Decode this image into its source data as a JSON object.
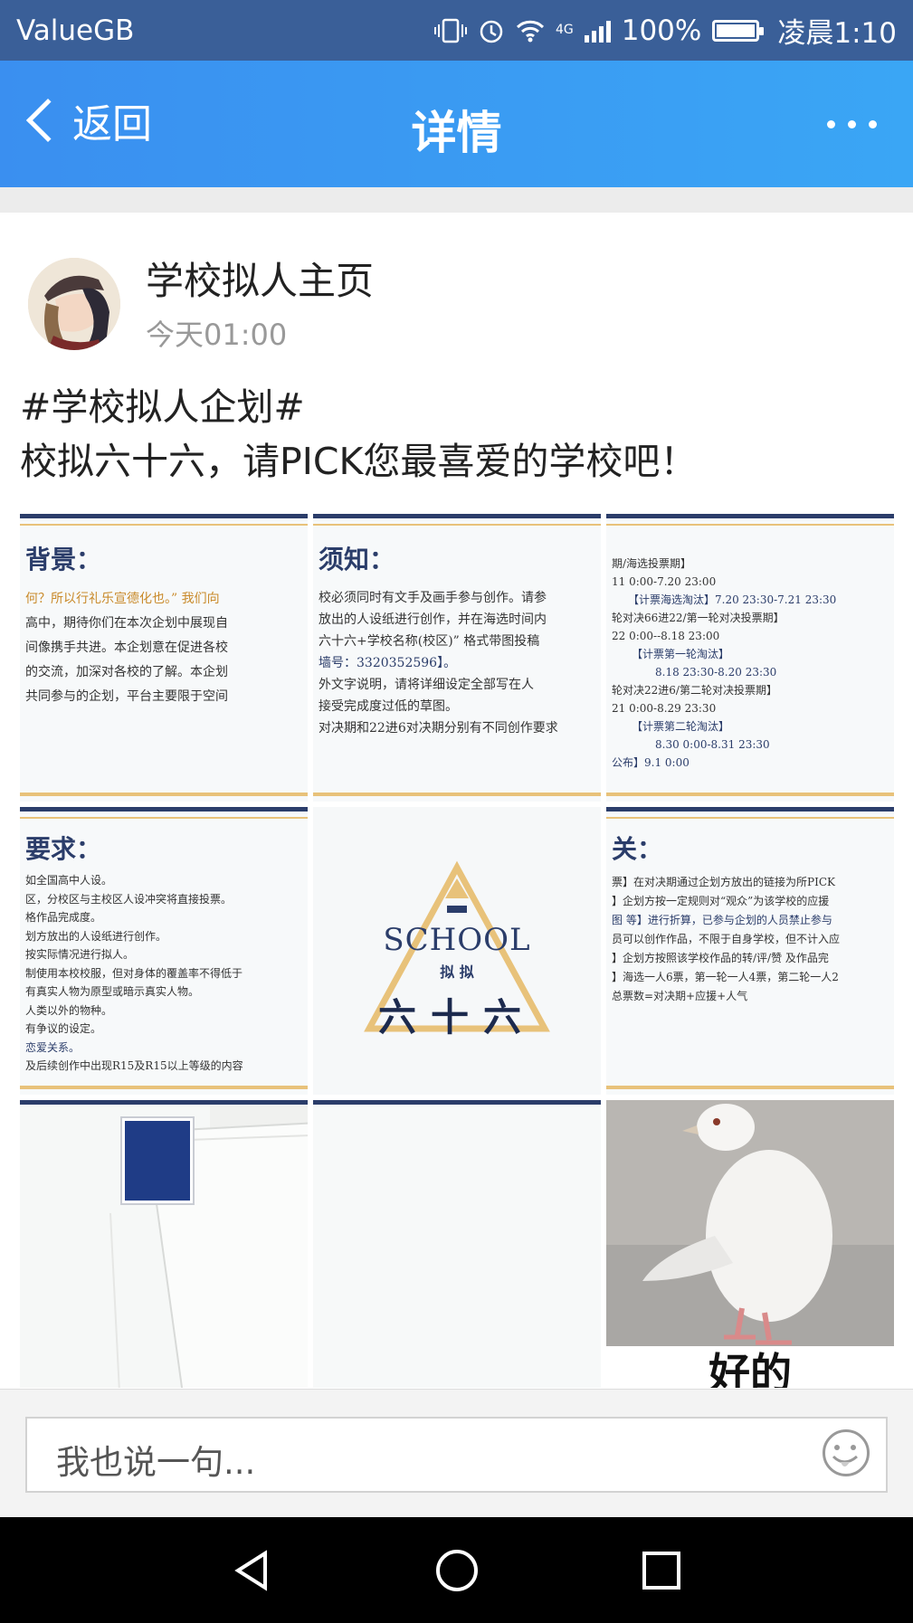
{
  "status_bar": {
    "carrier": "ValueGB",
    "network": "4G",
    "battery": "100%",
    "battery_level": 1.0,
    "time": "凌晨1:10"
  },
  "navbar": {
    "back_label": "返回",
    "title": "详情",
    "more_icon": "more-dots-icon"
  },
  "post": {
    "author": "学校拟人主页",
    "time": "今天01:00",
    "hashtag": "#学校拟人企划#",
    "text": "校拟六十六，请PICK您最喜爱的学校吧！"
  },
  "images": {
    "img1": {
      "title": "背景：",
      "lines": [
        "何？所以行礼乐宣德化也。” 我们向",
        "高中，期待你们在本次企划中展现自",
        "间像携手共进。本企划意在促进各校",
        "的交流，加深对各校的了解。本企划",
        "共同参与的企划，平台主要限于空间"
      ]
    },
    "img2": {
      "title": "须知：",
      "lines": [
        "校必须同时有文手及画手参与创作。请参",
        "放出的人设纸进行创作，并在海选时间内",
        "六十六+学校名称(校区)” 格式带图投稿",
        "墙号：3320352596】。",
        "",
        "外文字说明，请将详细设定全部写在人",
        "",
        "接受完成度过低的草图。",
        "",
        "对决期和22进6对决期分别有不同创作要求"
      ]
    },
    "img3": {
      "lines": [
        "期/海选投票期】",
        "11 0:00-7.20 23:00",
        "【计票海选淘汰】7.20 23:30-7.21 23:30",
        "轮对决66进22/第一轮对决投票期】",
        "22 0:00--8.18 23:00",
        "【计票第一轮淘汰】",
        "8.18 23:30-8.20 23:30",
        "轮对决22进6/第二轮对决投票期】",
        "21 0:00-8.29 23:30",
        "【计票第二轮淘汰】",
        "8.30 0:00-8.31 23:30",
        "",
        "公布】9.1 0:00"
      ]
    },
    "img4": {
      "title": "要求：",
      "lines": [
        "如全国高中人设。",
        "区，分校区与主校区人设冲突将直接投票。",
        "格作品完成度。",
        "划方放出的人设纸进行创作。",
        "按实际情况进行拟人。",
        "制使用本校校服，但对身体的覆盖率不得低于",
        "有真实人物为原型或暗示真实人物。",
        "人类以外的物种。",
        "有争议的设定。",
        "恋爱关系。",
        "及后续创作中出现R15及R15以上等级的内容"
      ]
    },
    "img5": {
      "school": "SCHOOL",
      "small": "拟 拟",
      "big": "六十六"
    },
    "img6": {
      "title": "关：",
      "lines": [
        "票】在对决期通过企划方放出的链接为所PICK",
        "】企划方按一定规则对“观众”为该学校的应援",
        "图 等】进行折算，已参与企划的人员禁止参与",
        "员可以创作作品，不限于自身学校，但不计入应",
        "",
        "】企划方按照该学校作品的转/评/赞 及作品完",
        "",
        "】海选一人6票，第一轮一人4票，第二轮一人2",
        "",
        "总票数=对决期+应援+人气"
      ]
    },
    "img9": {
      "caption": "好的"
    }
  },
  "comment": {
    "placeholder": "我也说一句...",
    "emoji_icon": "emoji-icon"
  },
  "colors": {
    "nav_start": "#3a8ff0",
    "nav_end": "#3aa6f5",
    "status_bg": "#3a5f98",
    "doc_navy": "#2b3d6a",
    "doc_gold": "#e8c27a"
  }
}
